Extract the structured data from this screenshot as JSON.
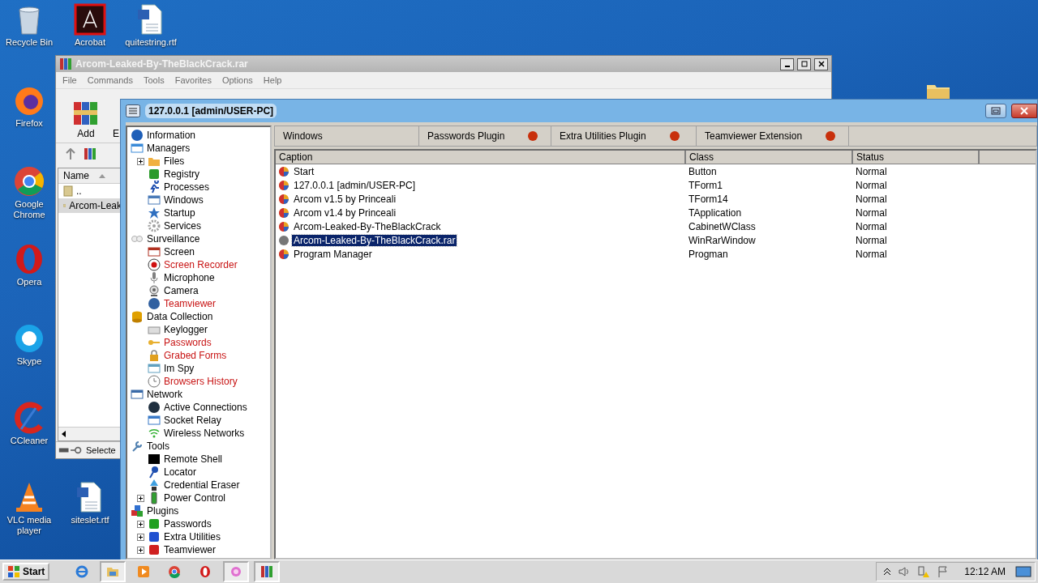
{
  "desktop": {
    "icons": [
      {
        "label": "Recycle Bin"
      },
      {
        "label": "Acrobat"
      },
      {
        "label": "quitestring.rtf"
      },
      {
        "label": "Firefox"
      },
      {
        "label": "Google Chrome"
      },
      {
        "label": "Opera"
      },
      {
        "label": "Skype"
      },
      {
        "label": "CCleaner"
      },
      {
        "label": "VLC media player"
      },
      {
        "label": "siteslet.rtf"
      }
    ]
  },
  "winrar_window": {
    "title": "Arcom-Leaked-By-TheBlackCrack.rar",
    "menu": [
      "File",
      "Commands",
      "Tools",
      "Favorites",
      "Options",
      "Help"
    ],
    "toolbar": [
      "Add",
      "E"
    ],
    "file_list": {
      "columns": [
        "Name"
      ],
      "rows": [
        {
          "name": "..",
          "selected": false
        },
        {
          "name": "Arcom-Leak",
          "selected": true
        }
      ]
    },
    "status_bar": "Selecte"
  },
  "main_window": {
    "title": "127.0.0.1 [admin/USER-PC]",
    "tree": [
      {
        "label": "Information",
        "color": "#000000"
      },
      {
        "label": "Managers",
        "color": "#000000",
        "children": [
          {
            "label": "Files",
            "color": "#000000",
            "expanded": false
          },
          {
            "label": "Registry",
            "color": "#000000"
          },
          {
            "label": "Processes",
            "color": "#000000"
          },
          {
            "label": "Windows",
            "color": "#000000"
          },
          {
            "label": "Startup",
            "color": "#000000"
          },
          {
            "label": "Services",
            "color": "#000000"
          }
        ]
      },
      {
        "label": "Surveillance",
        "color": "#000000",
        "children": [
          {
            "label": "Screen",
            "color": "#000000"
          },
          {
            "label": "Screen Recorder",
            "color": "#c81414"
          },
          {
            "label": "Microphone",
            "color": "#000000"
          },
          {
            "label": "Camera",
            "color": "#000000"
          },
          {
            "label": "Teamviewer",
            "color": "#c81414"
          }
        ]
      },
      {
        "label": "Data Collection",
        "color": "#000000",
        "children": [
          {
            "label": "Keylogger",
            "color": "#000000"
          },
          {
            "label": "Passwords",
            "color": "#c81414"
          },
          {
            "label": "Grabed Forms",
            "color": "#c81414"
          },
          {
            "label": "Im Spy",
            "color": "#000000"
          },
          {
            "label": "Browsers History",
            "color": "#c81414"
          }
        ]
      },
      {
        "label": "Network",
        "color": "#000000",
        "children": [
          {
            "label": "Active Connections",
            "color": "#000000"
          },
          {
            "label": "Socket Relay",
            "color": "#000000"
          },
          {
            "label": "Wireless Networks",
            "color": "#000000"
          }
        ]
      },
      {
        "label": "Tools",
        "color": "#000000",
        "children": [
          {
            "label": "Remote Shell",
            "color": "#000000"
          },
          {
            "label": "Locator",
            "color": "#000000"
          },
          {
            "label": "Credential Eraser",
            "color": "#000000"
          },
          {
            "label": "Power Control",
            "color": "#000000",
            "expanded": false
          }
        ]
      },
      {
        "label": "Plugins",
        "color": "#000000",
        "children": [
          {
            "label": "Passwords",
            "color": "#000000",
            "expanded": false
          },
          {
            "label": "Extra Utilities",
            "color": "#000000",
            "expanded": false
          },
          {
            "label": "Teamviewer",
            "color": "#000000",
            "expanded": false
          }
        ]
      }
    ],
    "tabs": [
      {
        "label": "Windows",
        "indicator": false
      },
      {
        "label": "Passwords Plugin",
        "indicator": true
      },
      {
        "label": "Extra Utilities Plugin",
        "indicator": true
      },
      {
        "label": "Teamviewer Extension",
        "indicator": true
      }
    ],
    "table": {
      "columns": [
        "Caption",
        "Class",
        "Status"
      ],
      "rows": [
        {
          "caption": "Start",
          "class": "Button",
          "status": "Normal",
          "selected": false
        },
        {
          "caption": "127.0.0.1 [admin/USER-PC]",
          "class": "TForm1",
          "status": "Normal",
          "selected": false
        },
        {
          "caption": "Arcom v1.5 by Princeali",
          "class": "TForm14",
          "status": "Normal",
          "selected": false
        },
        {
          "caption": "Arcom v1.4 by Princeali",
          "class": "TApplication",
          "status": "Normal",
          "selected": false
        },
        {
          "caption": "Arcom-Leaked-By-TheBlackCrack",
          "class": "CabinetWClass",
          "status": "Normal",
          "selected": false
        },
        {
          "caption": "Arcom-Leaked-By-TheBlackCrack.rar",
          "class": "WinRarWindow",
          "status": "Normal",
          "selected": true
        },
        {
          "caption": "Program Manager",
          "class": "Progman",
          "status": "Normal",
          "selected": false
        }
      ]
    }
  },
  "taskbar": {
    "start": "Start",
    "clock": "12:12 AM"
  }
}
